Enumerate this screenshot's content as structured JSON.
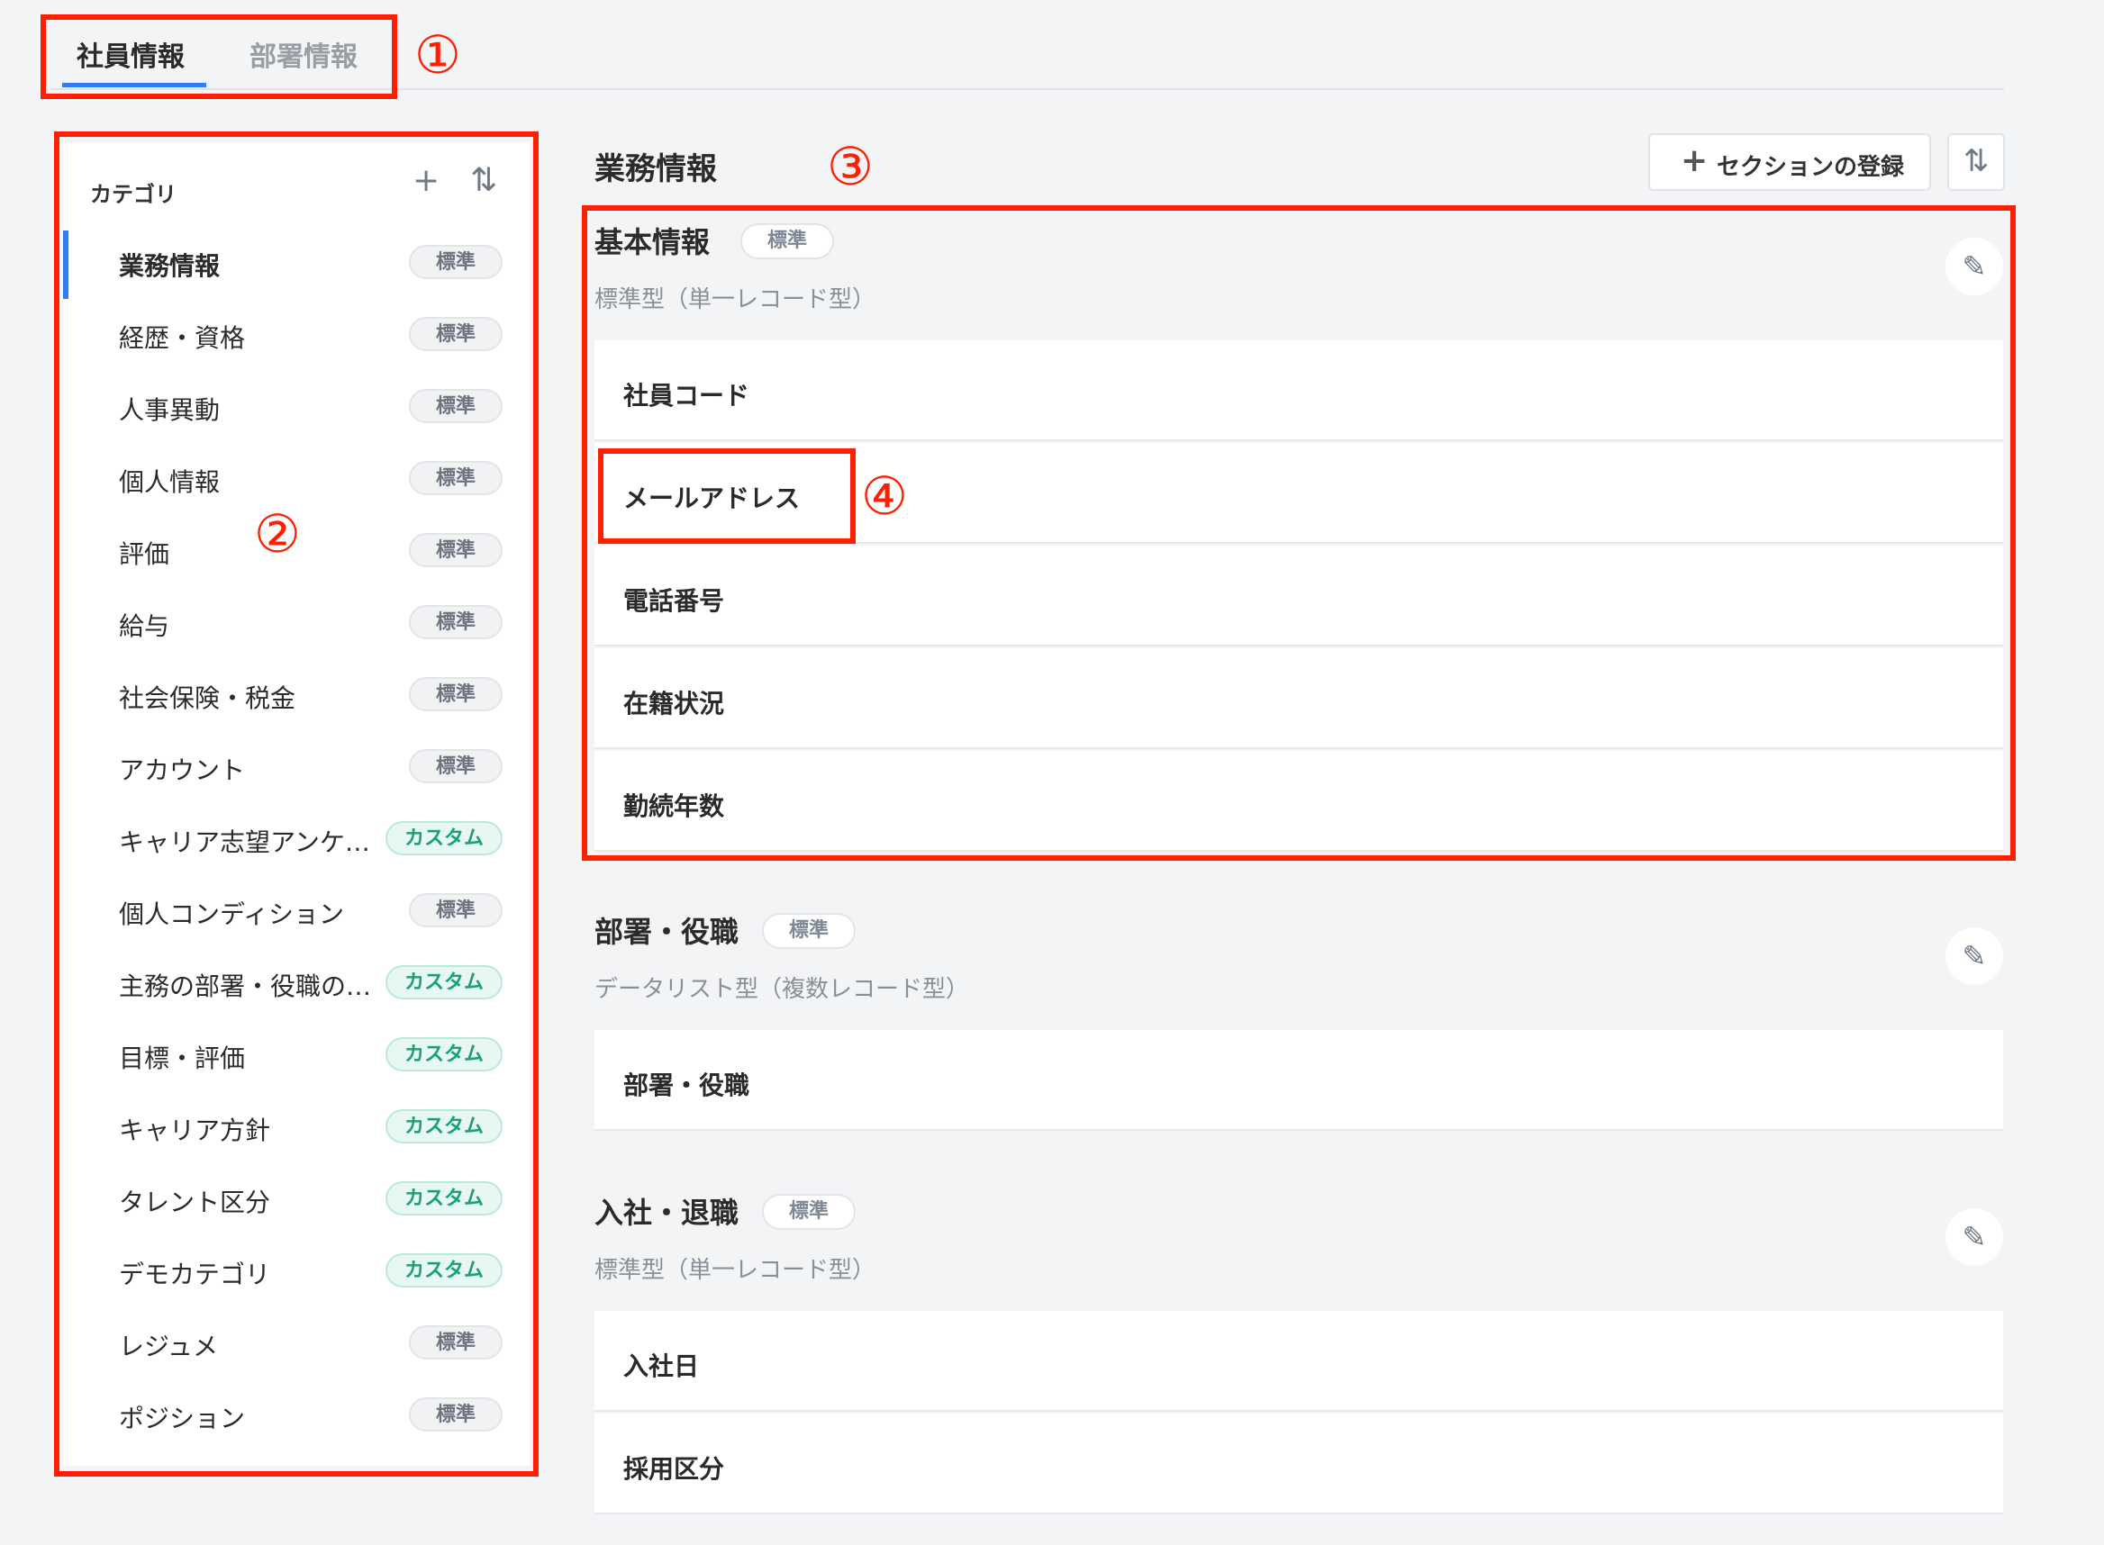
{
  "tabs": {
    "active": "社員情報",
    "inactive": "部署情報"
  },
  "markers": {
    "m1": "①",
    "m2": "②",
    "m3": "③",
    "m4": "④"
  },
  "sidebar": {
    "header": "カテゴリ",
    "add_icon": "+",
    "sort_icon": "⇅",
    "items": [
      {
        "label": "業務情報",
        "badge": "標準",
        "kind": "std"
      },
      {
        "label": "経歴・資格",
        "badge": "標準",
        "kind": "std"
      },
      {
        "label": "人事異動",
        "badge": "標準",
        "kind": "std"
      },
      {
        "label": "個人情報",
        "badge": "標準",
        "kind": "std"
      },
      {
        "label": "評価",
        "badge": "標準",
        "kind": "std"
      },
      {
        "label": "給与",
        "badge": "標準",
        "kind": "std"
      },
      {
        "label": "社会保険・税金",
        "badge": "標準",
        "kind": "std"
      },
      {
        "label": "アカウント",
        "badge": "標準",
        "kind": "std"
      },
      {
        "label": "キャリア志望アンケ…",
        "badge": "カスタム",
        "kind": "cus"
      },
      {
        "label": "個人コンディション",
        "badge": "標準",
        "kind": "std"
      },
      {
        "label": "主務の部署・役職の…",
        "badge": "カスタム",
        "kind": "cus"
      },
      {
        "label": "目標・評価",
        "badge": "カスタム",
        "kind": "cus"
      },
      {
        "label": "キャリア方針",
        "badge": "カスタム",
        "kind": "cus"
      },
      {
        "label": "タレント区分",
        "badge": "カスタム",
        "kind": "cus"
      },
      {
        "label": "デモカテゴリ",
        "badge": "カスタム",
        "kind": "cus"
      },
      {
        "label": "レジュメ",
        "badge": "標準",
        "kind": "std"
      },
      {
        "label": "ポジション",
        "badge": "標準",
        "kind": "std"
      }
    ]
  },
  "main": {
    "title": "業務情報",
    "register_button": "セクションの登録",
    "register_plus": "+",
    "sort_icon": "⇅",
    "edit_icon": "✎",
    "sections": [
      {
        "title": "基本情報",
        "badge": "標準",
        "subtitle": "標準型（単一レコード型）",
        "fields": [
          "社員コード",
          "メールアドレス",
          "電話番号",
          "在籍状況",
          "勤続年数"
        ]
      },
      {
        "title": "部署・役職",
        "badge": "標準",
        "subtitle": "データリスト型（複数レコード型）",
        "fields": [
          "部署・役職"
        ]
      },
      {
        "title": "入社・退職",
        "badge": "標準",
        "subtitle": "標準型（単一レコード型）",
        "fields": [
          "入社日",
          "採用区分"
        ]
      }
    ]
  }
}
